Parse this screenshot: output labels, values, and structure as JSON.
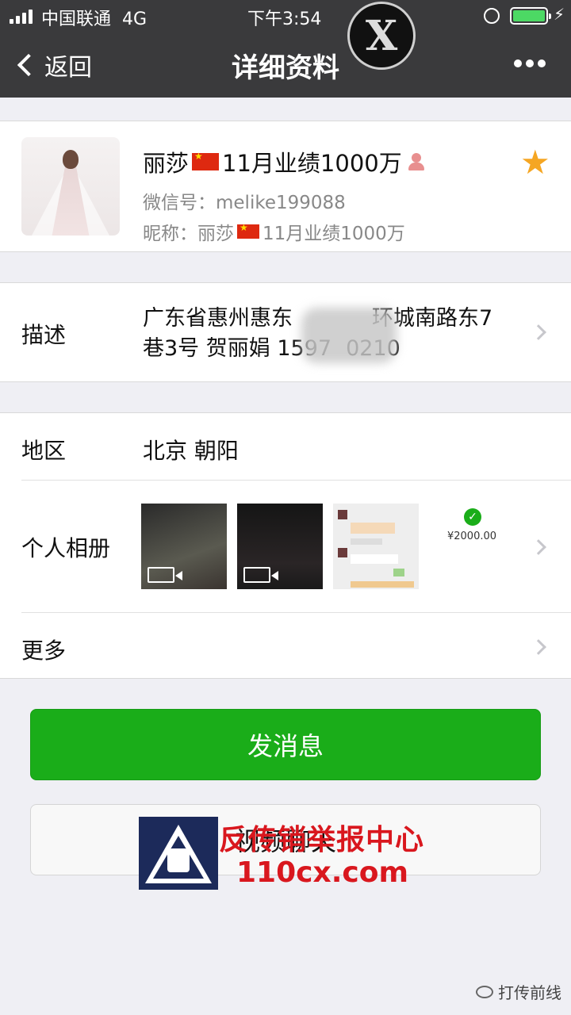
{
  "status_bar": {
    "carrier": "中国联通",
    "network": "4G",
    "time": "下午3:54",
    "battery_color": "#4cd964"
  },
  "overlay_logo": {
    "letter": "X"
  },
  "nav": {
    "back_label": "返回",
    "title": "详细资料",
    "more_icon": "more-dots-icon"
  },
  "profile": {
    "name_prefix": "丽莎",
    "name_suffix": "11月业绩1000万",
    "wechat_id": "微信号：melike199088",
    "nickname_label": "昵称：",
    "nickname_prefix": "丽莎",
    "nickname_suffix": "11月业绩1000万",
    "star_icon": "star-icon",
    "star_color": "#f5a623"
  },
  "description": {
    "label": "描述",
    "text_line1": "广东省惠州惠东",
    "text_line1_end": "环城南路东7",
    "text_line2_start": "巷3号 贺丽娟 1597",
    "text_line2_end": "0210"
  },
  "region": {
    "label": "地区",
    "value": "北京 朝阳"
  },
  "album": {
    "label": "个人相册",
    "amount": "¥2000.00"
  },
  "more": {
    "label": "更多"
  },
  "actions": {
    "send_label": "发消息",
    "video_label": "视频聊天",
    "send_color": "#1aad19"
  },
  "watermark": {
    "line1": "反传销举报中心",
    "line2": "110cx.com",
    "corner": "打传前线"
  }
}
